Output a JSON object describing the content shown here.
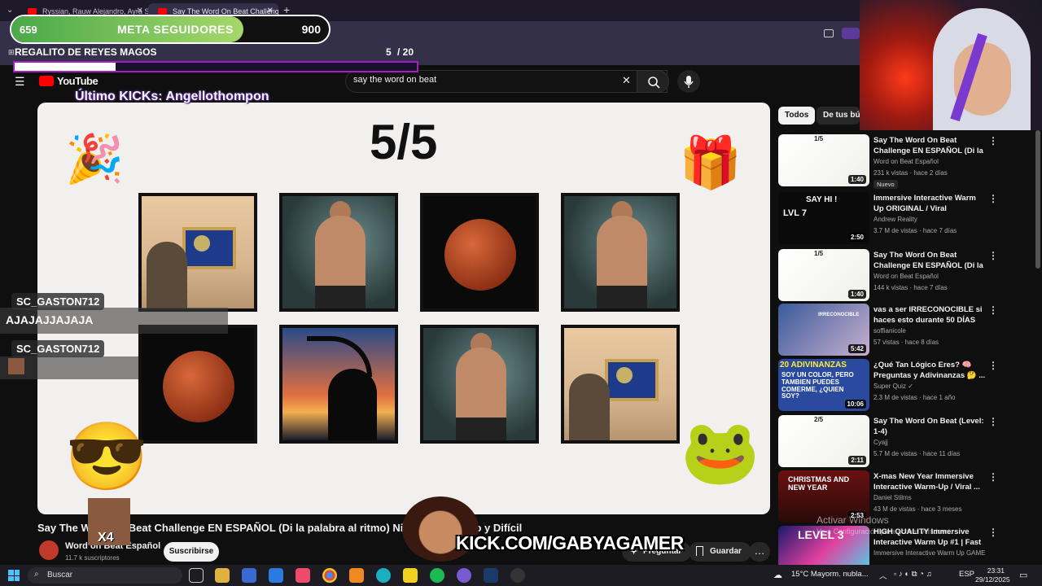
{
  "browser": {
    "tabs": [
      {
        "label": "Ryssian, Rauw Alejandro, Ayra S",
        "active": false
      },
      {
        "label": "Say The Word On Beat Challenge",
        "active": true
      }
    ],
    "new_tab": "+"
  },
  "overlays": {
    "goal": {
      "current": "659",
      "title": "META SEGUIDORES",
      "target": "900",
      "progress": 0.732
    },
    "gift": {
      "title": "REGALITO DE REYES MAGOS",
      "count": "5",
      "total": "/ 20",
      "progress": 0.25
    },
    "last_kicks": "Último KICKs: Angellothompon",
    "chat": [
      {
        "user": "SC_GASTON712",
        "message": "AJAJAJJAJAJA"
      },
      {
        "user": "SC_GASTON712",
        "message": ""
      }
    ],
    "kick_url": "KICK.COM/GABYAGAMER",
    "meme_badge": "X4"
  },
  "youtube": {
    "logo": "YouTube",
    "search_value": "say the word on beat",
    "video": {
      "score": "5/5",
      "title": "Say The Word On Beat Challenge EN ESPAÑOL (Di la palabra al ritmo) Nivel Fácil, Medio y Difícil",
      "channel": "Word on Beat Español",
      "subscribers": "11.7 k suscriptores",
      "subscribe_label": "Suscribirse",
      "actions": [
        "Preguntar",
        "Guardar"
      ],
      "more": "…"
    },
    "chips": [
      "Todos",
      "De tus bús"
    ],
    "related": [
      {
        "title": "Say The Word On Beat Challenge EN ESPAÑOL (Di la ...",
        "channel": "Word on Beat Español",
        "meta": "231 k vistas · hace 2 días",
        "duration": "1:40",
        "badge": "Nuevo"
      },
      {
        "title": "Immersive Interactive Warm Up ORIGINAL / Viral Interactive ...",
        "channel": "Andrew Reality",
        "meta": "3.7 M de vistas · hace 7 días",
        "duration": "2:50",
        "badge": ""
      },
      {
        "title": "Say The Word On Beat Challenge EN ESPAÑOL (Di la ...",
        "channel": "Word on Beat Español",
        "meta": "144 k vistas · hace 7 días",
        "duration": "1:40",
        "badge": ""
      },
      {
        "title": "vas a ser IRRECONOCIBLE si haces esto durante 50 DÍAS",
        "channel": "soffianicole",
        "meta": "57 vistas · hace 8 días",
        "duration": "5:42",
        "badge": ""
      },
      {
        "title": "¿Qué Tan Lógico Eres? 🧠 Preguntas y Adivinanzas 🤔 ...",
        "channel": "Super Quiz ✓",
        "meta": "2.3 M de vistas · hace 1 año",
        "duration": "10:06",
        "badge": ""
      },
      {
        "title": "Say The Word On Beat (Level: 1-4)",
        "channel": "Cyajj",
        "meta": "5.7 M de vistas · hace 11 días",
        "duration": "2:11",
        "badge": ""
      },
      {
        "title": "X-mas New Year Immersive Interactive Warm-Up / Viral ...",
        "channel": "Daniel Stilms",
        "meta": "43 M de vistas · hace 3 meses",
        "duration": "2:53",
        "badge": ""
      },
      {
        "title": "HIGH QUALITY Immersive Interactive Warm Up #1 | Fast ...",
        "channel": "Immersive Interactive Warm Up GAME",
        "meta": "",
        "duration": "",
        "badge": ""
      }
    ],
    "thumb_text": {
      "t1": "1/5",
      "t2_top": "SAY HI !",
      "t2_lvl": "LVL 7",
      "t4": "IRRECONOCIBLE",
      "t5_top": "20 ADIVINANZAS",
      "t5_body": "SOY UN COLOR, PERO TAMBIEN PUEDES COMERME, ¿QUIEN SOY?",
      "t6": "2/5",
      "t7": "CHRISTMAS AND NEW YEAR",
      "t8": "LEVEL 3"
    }
  },
  "windows": {
    "activate_title": "Activar Windows",
    "activate_sub": "Ve a Configuración para activar Windows.",
    "taskbar": {
      "search_placeholder": "Buscar",
      "weather": "15°C  Mayorm. nubla...",
      "lang": "ESP",
      "time": "23:31",
      "date": "29/12/2025"
    }
  },
  "colors": {
    "youtube_red": "#ff0000",
    "goal_green": "#7cc45a",
    "gift_border": "#a020c0",
    "background": "#0f0f0f"
  }
}
